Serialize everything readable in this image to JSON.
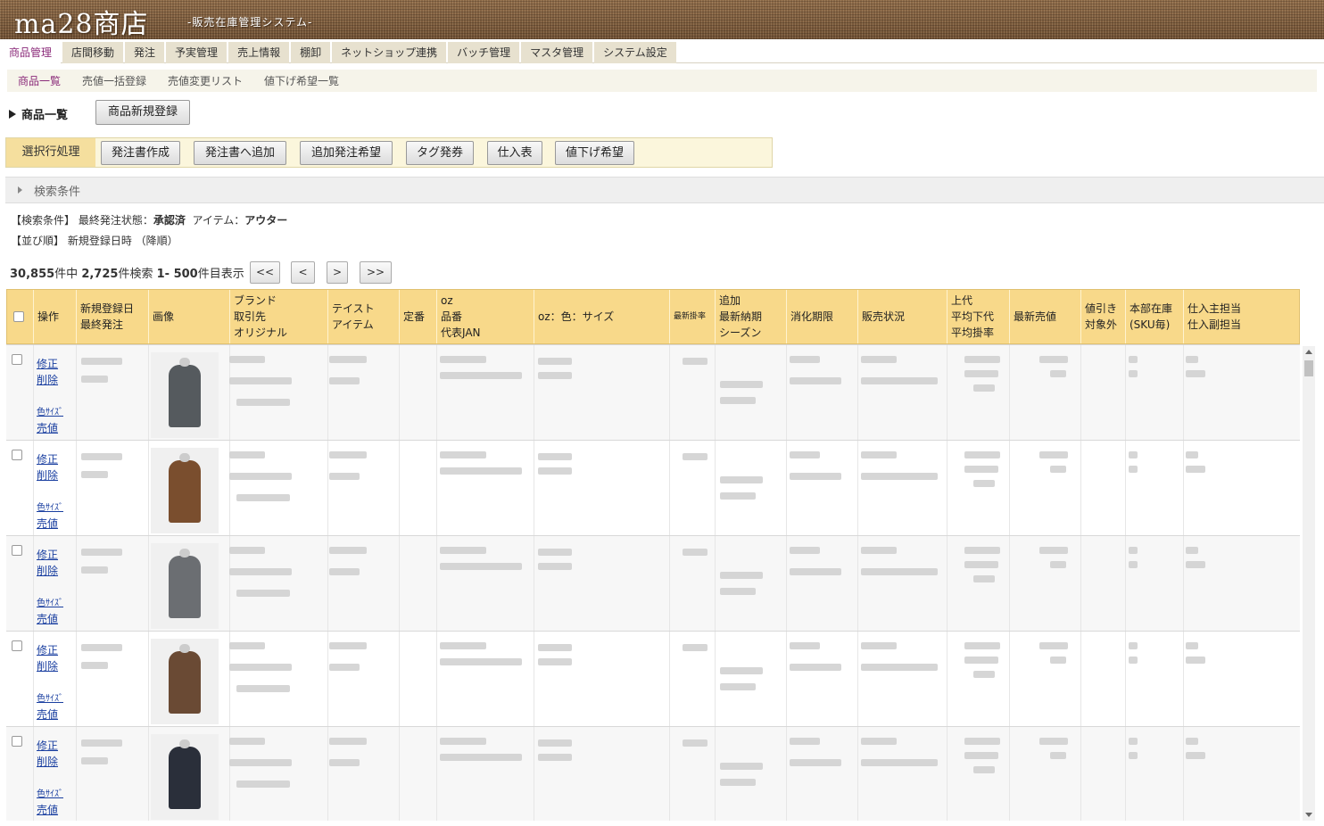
{
  "header": {
    "logo": "ma28商店",
    "subtitle": "-販売在庫管理システム-"
  },
  "main_nav": [
    {
      "label": "商品管理",
      "active": true
    },
    {
      "label": "店間移動",
      "active": false
    },
    {
      "label": "発注",
      "active": false
    },
    {
      "label": "予実管理",
      "active": false
    },
    {
      "label": "売上情報",
      "active": false
    },
    {
      "label": "棚卸",
      "active": false
    },
    {
      "label": "ネットショップ連携",
      "active": false
    },
    {
      "label": "バッチ管理",
      "active": false
    },
    {
      "label": "マスタ管理",
      "active": false
    },
    {
      "label": "システム設定",
      "active": false
    }
  ],
  "sub_nav": [
    {
      "label": "商品一覧",
      "active": true
    },
    {
      "label": "売値一括登録",
      "active": false
    },
    {
      "label": "売値変更リスト",
      "active": false
    },
    {
      "label": "値下げ希望一覧",
      "active": false
    }
  ],
  "page": {
    "title": "商品一覧",
    "new_button": "商品新規登録"
  },
  "bulk": {
    "label": "選択行処理",
    "buttons": [
      "発注書作成",
      "発注書へ追加",
      "追加発注希望",
      "タグ発券",
      "仕入表",
      "値下げ希望"
    ]
  },
  "search": {
    "toggle_label": "検索条件"
  },
  "conditions": {
    "line1_prefix": "【検索条件】 最終発注状態：",
    "status_value": "承認済",
    "item_prefix": "アイテム：",
    "item_value": "アウター",
    "line2": "【並び順】 新規登録日時 （降順）"
  },
  "pager": {
    "total": "30,855",
    "total_suffix": "件中",
    "found": "2,725",
    "found_suffix": "件検索",
    "range": "1- 500",
    "range_suffix": "件目表示",
    "first": "<<",
    "prev": "<",
    "next": ">",
    "last": ">>"
  },
  "table": {
    "headers": {
      "op": "操作",
      "date": [
        "新規登録日",
        "最終発注"
      ],
      "image": "画像",
      "brand": [
        "ブランド",
        "取引先",
        "オリジナル"
      ],
      "taste": [
        "テイスト",
        "アイテム"
      ],
      "teiban": "定番",
      "oz": [
        "oz",
        "品番",
        "代表JAN"
      ],
      "ozcolor": "oz：色：サイズ",
      "rate": "最新掛率",
      "add": [
        "追加",
        "最新納期",
        "シーズン"
      ],
      "expiry": "消化期限",
      "sales": "販売状況",
      "price": [
        "上代",
        "平均下代",
        "平均掛率"
      ],
      "latest": "最新売値",
      "discount": [
        "値引き",
        "対象外"
      ],
      "stock": [
        "本部在庫",
        "(SKU毎)"
      ],
      "staff": [
        "仕入主担当",
        "仕入副担当"
      ]
    },
    "row_links": {
      "edit": "修正",
      "delete": "削除",
      "color_size": "色ｻｲｽﾞ",
      "price": "売値"
    },
    "rows": [
      {
        "garment_color": "#555a5e"
      },
      {
        "garment_color": "#7a4e2e"
      },
      {
        "garment_color": "#6b6e72"
      },
      {
        "garment_color": "#6a4a34"
      },
      {
        "garment_color": "#2a2f3a"
      }
    ]
  }
}
